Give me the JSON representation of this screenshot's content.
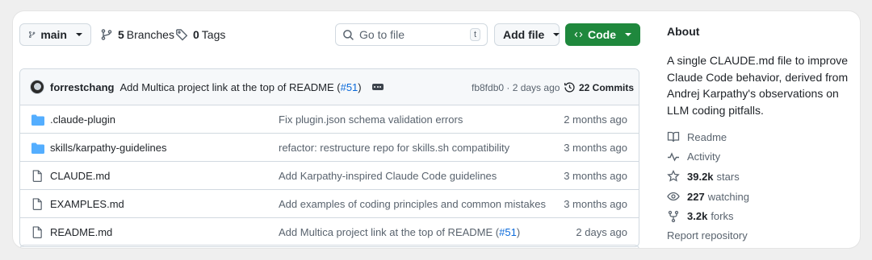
{
  "toolbar": {
    "branch": "main",
    "branches_count": "5",
    "branches_label": "Branches",
    "tags_count": "0",
    "tags_label": "Tags",
    "search_placeholder": "Go to file",
    "search_shortcut": "t",
    "add_file": "Add file",
    "code": "Code"
  },
  "latest_commit": {
    "author": "forrestchang",
    "message": "Add Multica project link at the top of README (",
    "pr": "#51",
    "message_end": ")",
    "sha_age": "fb8fdb0 · 2 days ago",
    "commits_count": "22 Commits"
  },
  "files": [
    {
      "type": "dir",
      "name": ".claude-plugin",
      "message": "Fix plugin.json schema validation errors",
      "age": "2 months ago"
    },
    {
      "type": "dir",
      "name": "skills/karpathy-guidelines",
      "message": "refactor: restructure repo for skills.sh compatibility",
      "age": "3 months ago"
    },
    {
      "type": "file",
      "name": "CLAUDE.md",
      "message": "Add Karpathy-inspired Claude Code guidelines",
      "age": "3 months ago"
    },
    {
      "type": "file",
      "name": "EXAMPLES.md",
      "message": "Add examples of coding principles and common mistakes",
      "age": "3 months ago"
    },
    {
      "type": "file",
      "name": "README.md",
      "message": "Add Multica project link at the top of README (",
      "pr": "#51",
      "message_end": ")",
      "age": "2 days ago"
    }
  ],
  "about": {
    "heading": "About",
    "description": "A single CLAUDE.md file to improve Claude Code behavior, derived from Andrej Karpathy's observations on LLM coding pitfalls.",
    "readme": "Readme",
    "activity": "Activity",
    "stars_count": "39.2k",
    "stars_label": "stars",
    "watching_count": "227",
    "watching_label": "watching",
    "forks_count": "3.2k",
    "forks_label": "forks",
    "report": "Report repository"
  },
  "colors": {
    "accent_green": "#1f883d",
    "folder_blue": "#54aeff",
    "link_blue": "#0969da"
  },
  "icons": [
    "git-branch-icon",
    "tag-icon",
    "search-icon",
    "code-icon",
    "history-icon",
    "folder-icon",
    "file-icon",
    "book-icon",
    "pulse-icon",
    "star-icon",
    "eye-icon",
    "fork-icon"
  ]
}
